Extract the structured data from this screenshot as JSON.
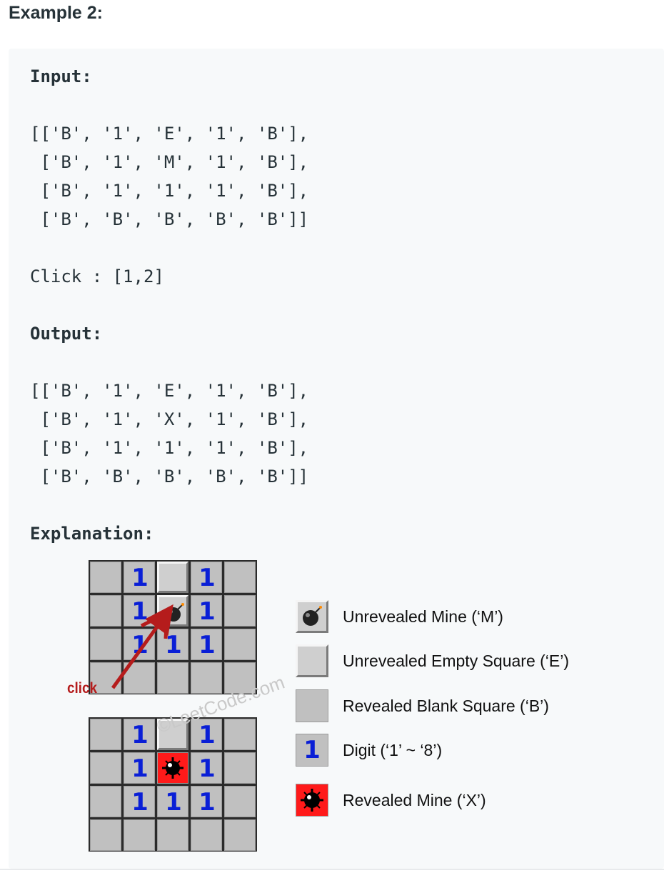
{
  "heading": "Example 2:",
  "input_label": "Input:",
  "input_rows": [
    "[['B', '1', 'E', '1', 'B'],",
    " ['B', '1', 'M', '1', 'B'],",
    " ['B', '1', '1', '1', 'B'],",
    " ['B', 'B', 'B', 'B', 'B']]"
  ],
  "click_line": "Click : [1,2]",
  "output_label": "Output:",
  "output_rows": [
    "[['B', '1', 'E', '1', 'B'],",
    " ['B', '1', 'X', '1', 'B'],",
    " ['B', '1', '1', '1', 'B'],",
    " ['B', 'B', 'B', 'B', 'B']]"
  ],
  "explanation_label": "Explanation:",
  "board_before": [
    [
      "B",
      "1",
      "E",
      "1",
      "B"
    ],
    [
      "B",
      "1",
      "M",
      "1",
      "B"
    ],
    [
      "B",
      "1",
      "1",
      "1",
      "B"
    ],
    [
      "B",
      "B",
      "B",
      "B",
      "B"
    ]
  ],
  "board_after": [
    [
      "B",
      "1",
      "E",
      "1",
      "B"
    ],
    [
      "B",
      "1",
      "X",
      "1",
      "B"
    ],
    [
      "B",
      "1",
      "1",
      "1",
      "B"
    ],
    [
      "B",
      "B",
      "B",
      "B",
      "B"
    ]
  ],
  "click_annotation": "click",
  "watermark": "©LeetCode.com",
  "legend": {
    "unrevealed_mine": "Unrevealed Mine (‘M’)",
    "unrevealed_empty": "Unrevealed Empty Square (‘E’)",
    "revealed_blank": "Revealed Blank Square (‘B’)",
    "digit": "Digit (‘1’ ~ ‘8’)",
    "digit_sample": "1",
    "revealed_mine": "Revealed Mine (‘X’)"
  },
  "colors": {
    "digit": "#0a1fd6",
    "revealed_mine_bg": "#ff1a1a",
    "arrow": "#b51c1c"
  }
}
